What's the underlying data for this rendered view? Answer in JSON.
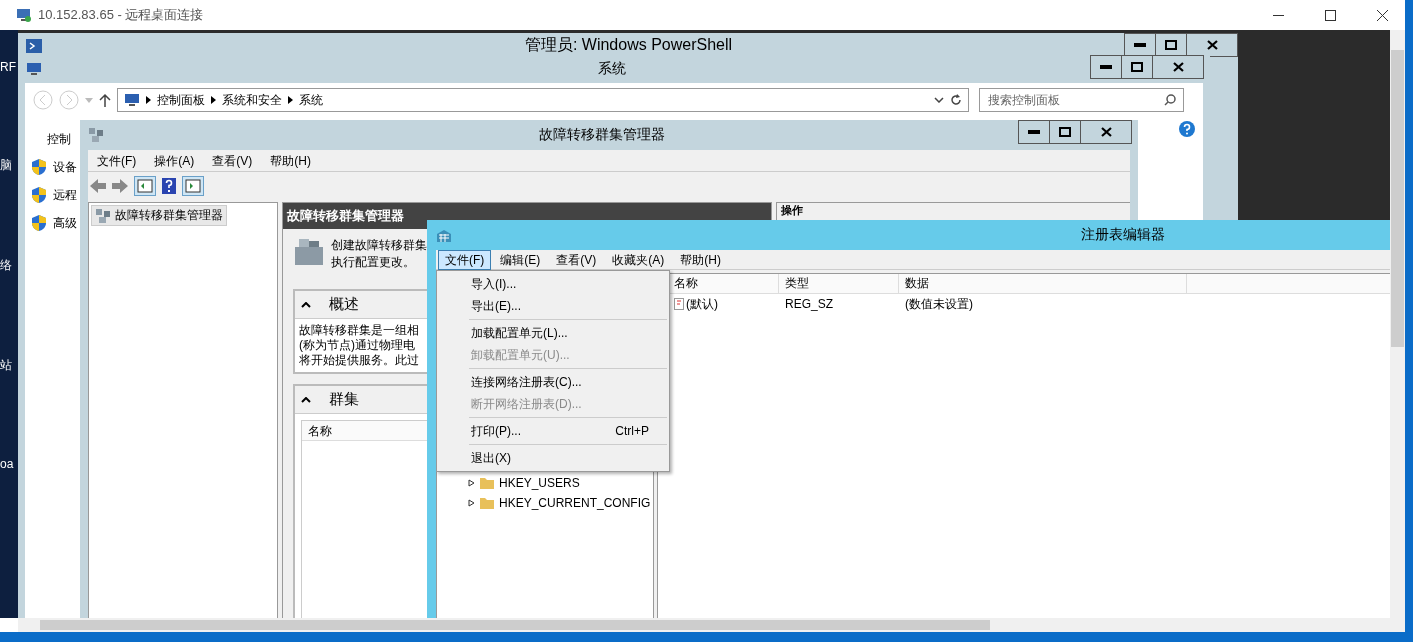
{
  "rdp_window": {
    "title": "10.152.83.65 - 远程桌面连接"
  },
  "desktop_icons": [
    {
      "label": "RF"
    },
    {
      "label": "脑"
    },
    {
      "label": "络"
    },
    {
      "label": "站"
    },
    {
      "label": "oa"
    }
  ],
  "powershell_window": {
    "title": "管理员: Windows PowerShell"
  },
  "system_window": {
    "title": "系统",
    "breadcrumbs": [
      "控制面板",
      "系统和安全",
      "系统"
    ],
    "search": {
      "placeholder": "搜索控制面板"
    },
    "sidebar": {
      "heading": "控制",
      "links": [
        "设备",
        "远程",
        "高级"
      ]
    }
  },
  "cluster_window": {
    "title": "故障转移群集管理器",
    "menu": [
      "文件(F)",
      "操作(A)",
      "查看(V)",
      "帮助(H)"
    ],
    "tree": [
      {
        "label": "故障转移群集管理器",
        "selected": true
      }
    ],
    "main": {
      "header": "故障转移群集管理器",
      "intro": [
        "创建故障转移群集",
        "执行配置更改。"
      ],
      "sections": [
        {
          "kind": "text",
          "title": "概述",
          "expanded": true,
          "lines": [
            "故障转移群集是一组相",
            "(称为节点)通过物理电",
            "将开始提供服务。此过"
          ]
        },
        {
          "kind": "table",
          "title": "群集",
          "expanded": true,
          "columns": [
            "名称"
          ]
        }
      ]
    },
    "actions": {
      "header": "操作"
    }
  },
  "registry_window": {
    "title": "注册表编辑器",
    "menu": [
      {
        "label": "文件(F)",
        "selected": true
      },
      {
        "label": "编辑(E)",
        "selected": false
      },
      {
        "label": "查看(V)",
        "selected": false
      },
      {
        "label": "收藏夹(A)",
        "selected": false
      },
      {
        "label": "帮助(H)",
        "selected": false
      }
    ],
    "file_menu": [
      {
        "kind": "item",
        "label": "导入(I)...",
        "disabled": false
      },
      {
        "kind": "item",
        "label": "导出(E)...",
        "disabled": false
      },
      {
        "kind": "separator"
      },
      {
        "kind": "item",
        "label": "加载配置单元(L)...",
        "disabled": false
      },
      {
        "kind": "item",
        "label": "卸载配置单元(U)...",
        "disabled": true
      },
      {
        "kind": "separator"
      },
      {
        "kind": "item",
        "label": "连接网络注册表(C)...",
        "disabled": false
      },
      {
        "kind": "item",
        "label": "断开网络注册表(D)...",
        "disabled": true
      },
      {
        "kind": "separator"
      },
      {
        "kind": "item",
        "label": "打印(P)...",
        "shortcut": "Ctrl+P",
        "disabled": false
      },
      {
        "kind": "separator"
      },
      {
        "kind": "item",
        "label": "退出(X)",
        "disabled": false
      }
    ],
    "tree": [
      {
        "label": "HKEY_USERS",
        "expanded": false
      },
      {
        "label": "HKEY_CURRENT_CONFIG",
        "expanded": false
      }
    ],
    "columns": [
      "名称",
      "类型",
      "数据"
    ],
    "rows": [
      {
        "cells": [
          "(默认)",
          "REG_SZ",
          "(数值未设置)"
        ]
      }
    ]
  }
}
